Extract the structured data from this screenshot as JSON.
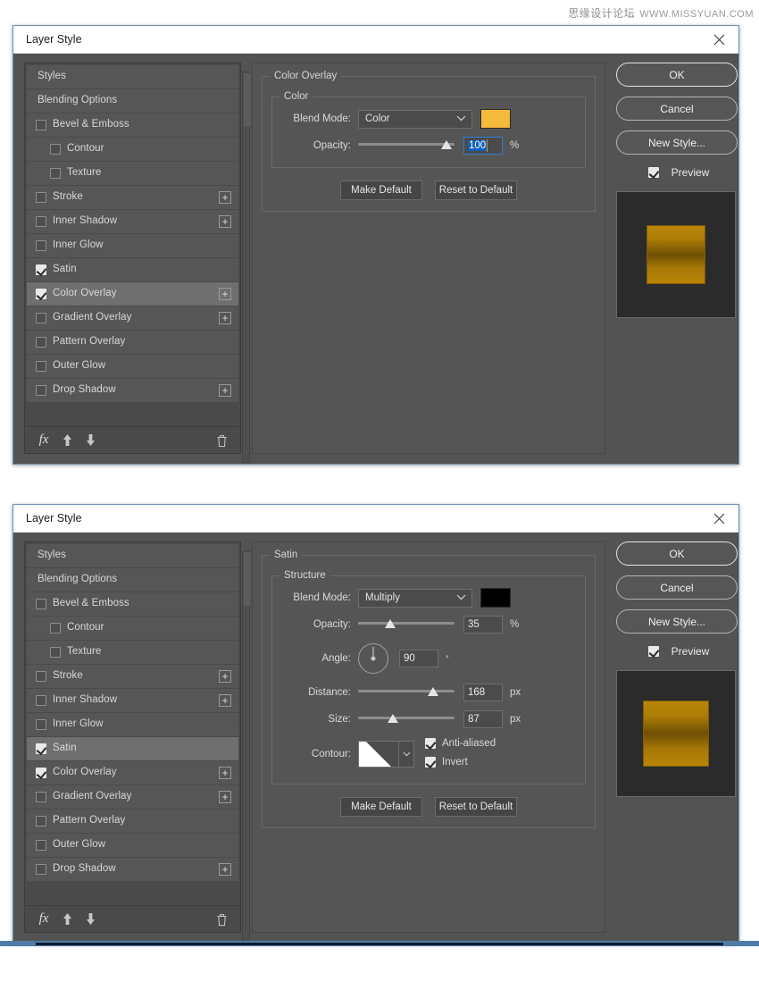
{
  "watermark": {
    "cn": "思缘设计论坛",
    "url": "WWW.MISSYUAN.COM"
  },
  "colors": {
    "overlay_swatch": "#F5B93C",
    "satin_swatch": "#000000",
    "dialog_bg": "#535353",
    "panel_bg": "#4a4a4a",
    "selection_blue": "#1060b8",
    "accent_border": "#6c8fae"
  },
  "effects_list": [
    {
      "label": "Styles",
      "type": "plain",
      "checkbox": null,
      "plus": false,
      "selected": false
    },
    {
      "label": "Blending Options",
      "type": "plain",
      "checkbox": null,
      "plus": false,
      "selected": false
    },
    {
      "label": "Bevel & Emboss",
      "type": "normal",
      "checkbox": false,
      "plus": false,
      "selected": false
    },
    {
      "label": "Contour",
      "type": "indent",
      "checkbox": false,
      "plus": false,
      "selected": false
    },
    {
      "label": "Texture",
      "type": "indent",
      "checkbox": false,
      "plus": false,
      "selected": false
    },
    {
      "label": "Stroke",
      "type": "normal",
      "checkbox": false,
      "plus": true,
      "selected": false
    },
    {
      "label": "Inner Shadow",
      "type": "normal",
      "checkbox": false,
      "plus": true,
      "selected": false
    },
    {
      "label": "Inner Glow",
      "type": "normal",
      "checkbox": false,
      "plus": false,
      "selected": false
    },
    {
      "label": "Satin",
      "type": "normal",
      "checkbox": true,
      "plus": false,
      "selected": false
    },
    {
      "label": "Color Overlay",
      "type": "normal",
      "checkbox": true,
      "plus": true,
      "selected": true
    },
    {
      "label": "Gradient Overlay",
      "type": "normal",
      "checkbox": false,
      "plus": true,
      "selected": false
    },
    {
      "label": "Pattern Overlay",
      "type": "normal",
      "checkbox": false,
      "plus": false,
      "selected": false
    },
    {
      "label": "Outer Glow",
      "type": "normal",
      "checkbox": false,
      "plus": false,
      "selected": false
    },
    {
      "label": "Drop Shadow",
      "type": "normal",
      "checkbox": false,
      "plus": true,
      "selected": false
    }
  ],
  "effects_list_2": [
    {
      "label": "Styles",
      "type": "plain",
      "checkbox": null,
      "plus": false,
      "selected": false
    },
    {
      "label": "Blending Options",
      "type": "plain",
      "checkbox": null,
      "plus": false,
      "selected": false
    },
    {
      "label": "Bevel & Emboss",
      "type": "normal",
      "checkbox": false,
      "plus": false,
      "selected": false
    },
    {
      "label": "Contour",
      "type": "indent",
      "checkbox": false,
      "plus": false,
      "selected": false
    },
    {
      "label": "Texture",
      "type": "indent",
      "checkbox": false,
      "plus": false,
      "selected": false
    },
    {
      "label": "Stroke",
      "type": "normal",
      "checkbox": false,
      "plus": true,
      "selected": false
    },
    {
      "label": "Inner Shadow",
      "type": "normal",
      "checkbox": false,
      "plus": true,
      "selected": false
    },
    {
      "label": "Inner Glow",
      "type": "normal",
      "checkbox": false,
      "plus": false,
      "selected": false
    },
    {
      "label": "Satin",
      "type": "normal",
      "checkbox": true,
      "plus": false,
      "selected": true
    },
    {
      "label": "Color Overlay",
      "type": "normal",
      "checkbox": true,
      "plus": true,
      "selected": false
    },
    {
      "label": "Gradient Overlay",
      "type": "normal",
      "checkbox": false,
      "plus": true,
      "selected": false
    },
    {
      "label": "Pattern Overlay",
      "type": "normal",
      "checkbox": false,
      "plus": false,
      "selected": false
    },
    {
      "label": "Outer Glow",
      "type": "normal",
      "checkbox": false,
      "plus": false,
      "selected": false
    },
    {
      "label": "Drop Shadow",
      "type": "normal",
      "checkbox": false,
      "plus": true,
      "selected": false
    }
  ],
  "footer_icons": {
    "fx": "fx",
    "up": "move-up",
    "down": "move-down",
    "trash": "delete"
  },
  "buttons": {
    "ok": "OK",
    "cancel": "Cancel",
    "new_style": "New Style...",
    "preview": "Preview",
    "make_default": "Make Default",
    "reset_to_default": "Reset to Default"
  },
  "dialog1": {
    "title": "Layer Style",
    "group_title": "Color Overlay",
    "subgroup_title": "Color",
    "fields": {
      "blend_mode_label": "Blend Mode:",
      "blend_mode_value": "Color",
      "opacity_label": "Opacity:",
      "opacity_value": "100",
      "opacity_unit": "%",
      "opacity_slider_pct": 92
    }
  },
  "dialog2": {
    "title": "Layer Style",
    "group_title": "Satin",
    "subgroup_title": "Structure",
    "fields": {
      "blend_mode_label": "Blend Mode:",
      "blend_mode_value": "Multiply",
      "opacity_label": "Opacity:",
      "opacity_value": "35",
      "opacity_unit": "%",
      "opacity_slider_pct": 33,
      "angle_label": "Angle:",
      "angle_value": "90",
      "angle_unit": "°",
      "distance_label": "Distance:",
      "distance_value": "168",
      "distance_unit": "px",
      "distance_slider_pct": 78,
      "size_label": "Size:",
      "size_value": "87",
      "size_unit": "px",
      "size_slider_pct": 36,
      "contour_label": "Contour:",
      "anti_aliased_label": "Anti-aliased",
      "anti_aliased_checked": true,
      "invert_label": "Invert",
      "invert_checked": true
    }
  }
}
